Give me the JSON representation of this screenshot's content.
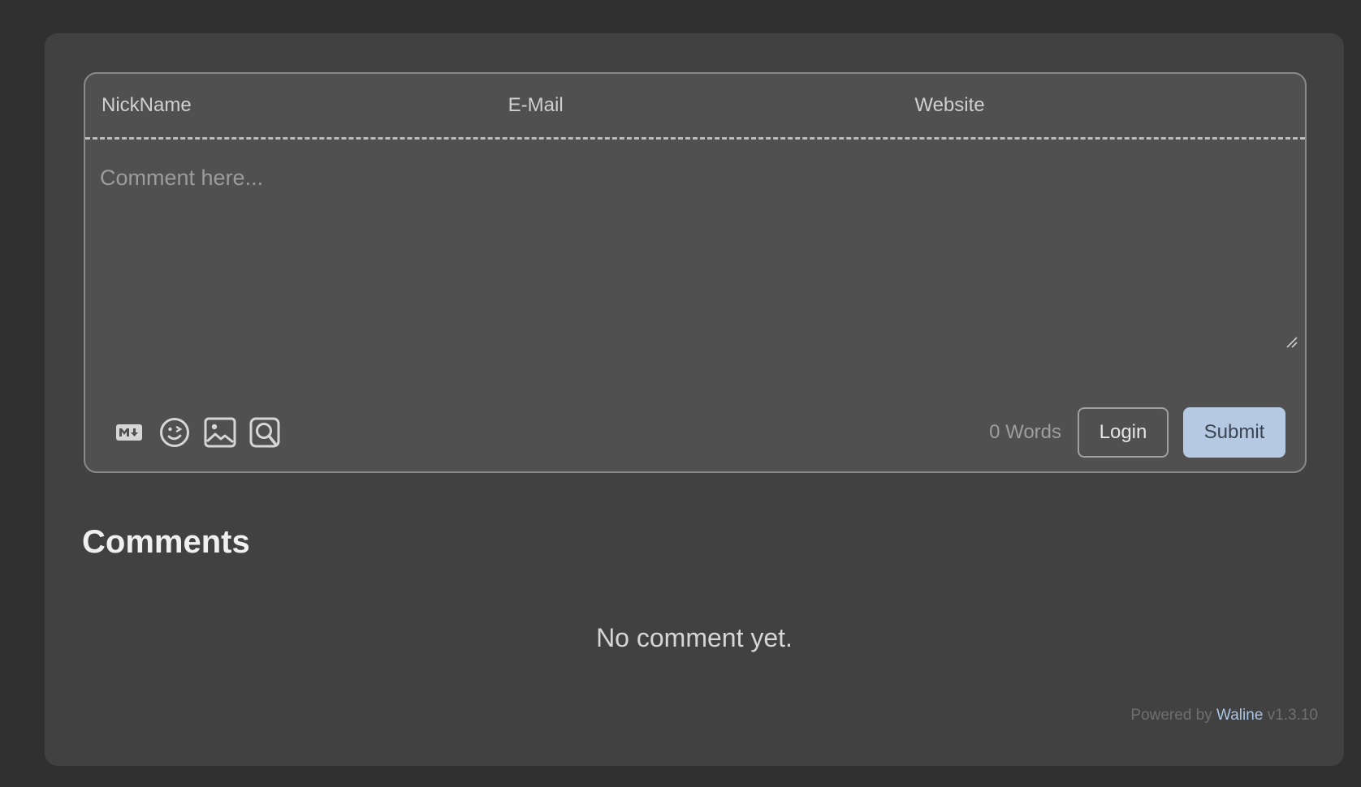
{
  "form": {
    "nickname_placeholder": "NickName",
    "email_placeholder": "E-Mail",
    "website_placeholder": "Website",
    "comment_placeholder": "Comment here...",
    "word_count": "0",
    "word_label": "Words",
    "login_label": "Login",
    "submit_label": "Submit",
    "tools": [
      "markdown-icon",
      "emoji-icon",
      "image-icon",
      "preview-icon"
    ]
  },
  "comments": {
    "title": "Comments",
    "empty_text": "No comment yet."
  },
  "footer": {
    "powered_by": "Powered by",
    "brand": "Waline",
    "version": "v1.3.10"
  },
  "colors": {
    "page_bg": "#303030",
    "card_bg": "#414141",
    "panel_bg": "#505050",
    "accent": "#b5c9e3",
    "link": "#a9c3e4"
  }
}
